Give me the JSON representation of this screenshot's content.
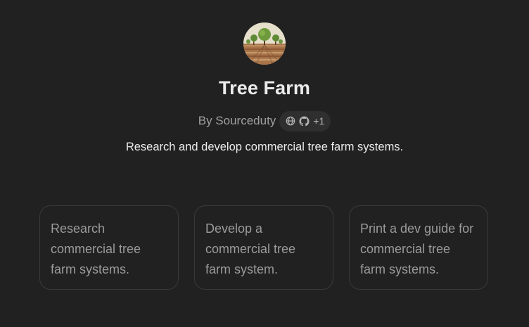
{
  "gpt": {
    "name": "Tree Farm",
    "byline": "By Sourceduty",
    "link_icons": [
      "globe-icon",
      "github-icon"
    ],
    "extra_links_count": "+1",
    "description": "Research and develop commercial tree farm systems."
  },
  "conversation_starters": [
    {
      "text": "Research commercial tree farm systems."
    },
    {
      "text": "Develop a commercial tree farm system."
    },
    {
      "text": "Print a dev guide for commercial tree farm systems."
    }
  ],
  "colors": {
    "background": "#212121",
    "title": "#ececec",
    "muted": "#a0a0a0",
    "pill": "#2f2f2f",
    "card_border": "#3a3a3a"
  }
}
